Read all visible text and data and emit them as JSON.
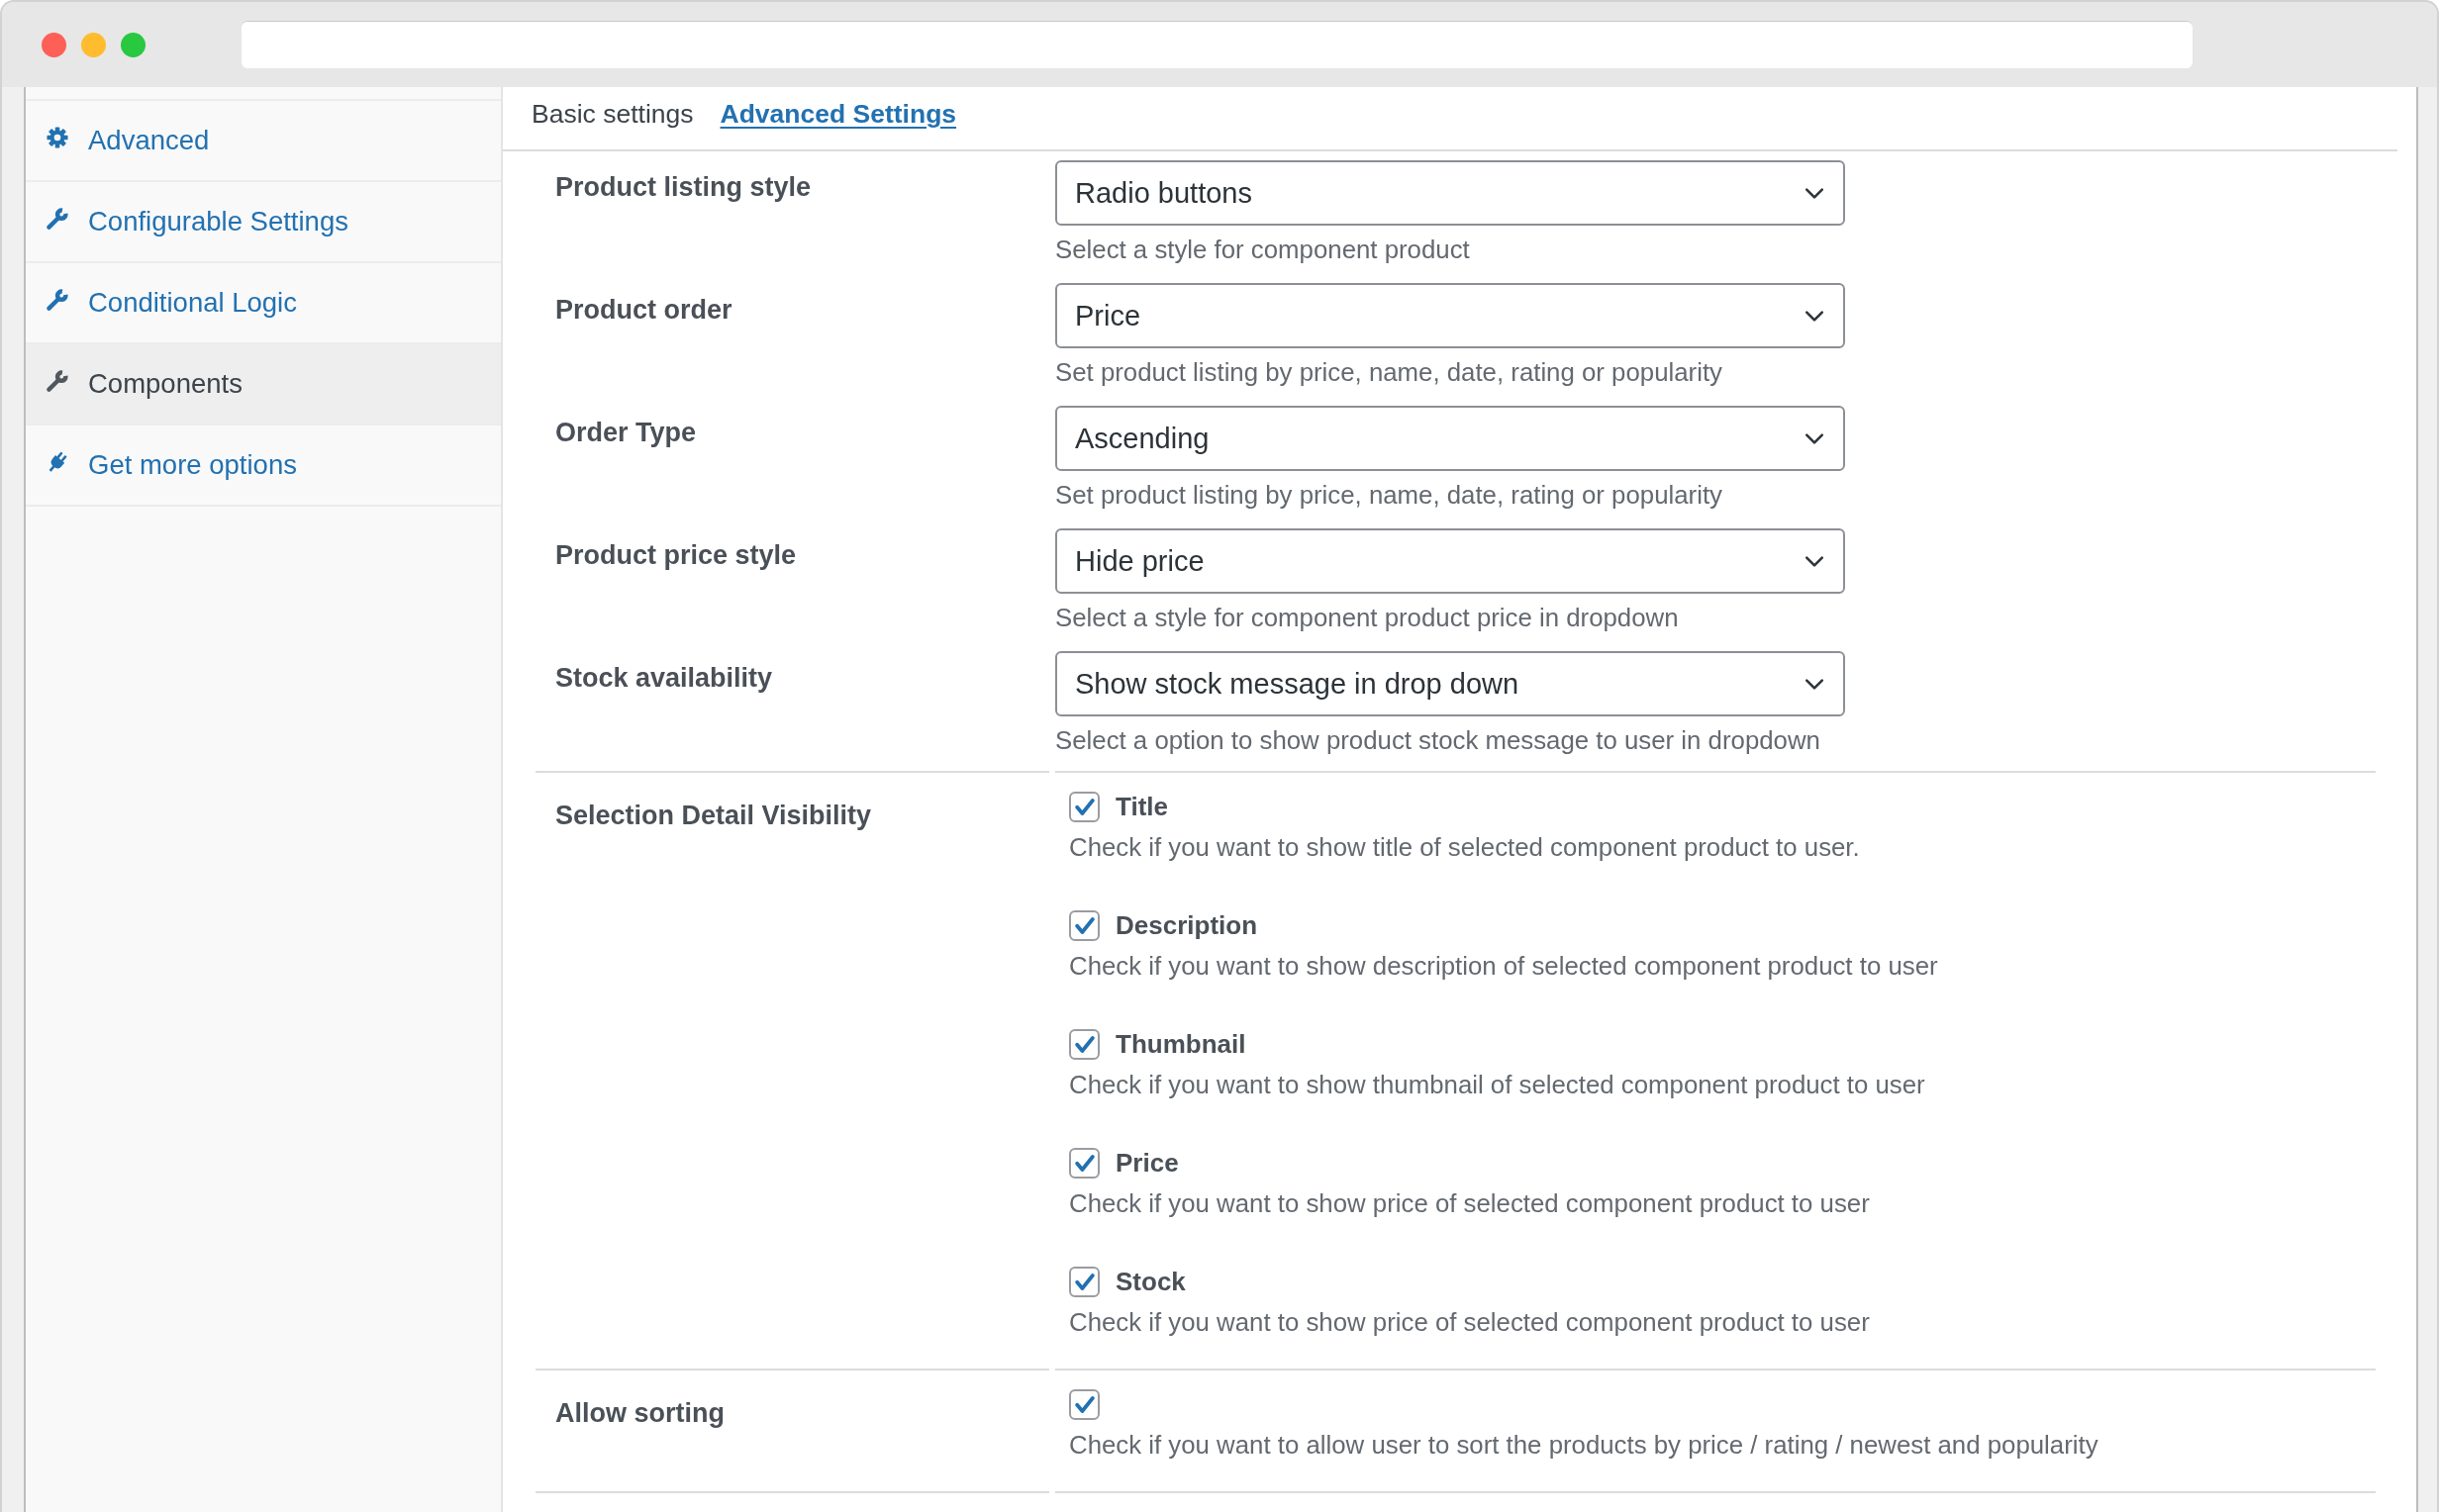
{
  "sidebar": {
    "items": [
      {
        "label": "Advanced",
        "selected": false
      },
      {
        "label": "Configurable Settings",
        "selected": false
      },
      {
        "label": "Conditional Logic",
        "selected": false
      },
      {
        "label": "Components",
        "selected": true
      },
      {
        "label": "Get more options",
        "selected": false
      }
    ]
  },
  "tabs": [
    {
      "label": "Basic settings",
      "selected": false
    },
    {
      "label": "Advanced Settings",
      "selected": true
    }
  ],
  "form": {
    "sections": [
      {
        "rows": [
          {
            "kind": "select",
            "label": "Product listing style",
            "value": "Radio buttons",
            "help": "Select a style for component product"
          },
          {
            "kind": "select",
            "label": "Product order",
            "value": "Price",
            "help": "Set product listing by price, name, date, rating or popularity"
          },
          {
            "kind": "select",
            "label": "Order Type",
            "value": "Ascending",
            "help": "Set product listing by price, name, date, rating or popularity"
          },
          {
            "kind": "select",
            "label": "Product price style",
            "value": "Hide price",
            "help": "Select a style for component product price in dropdown"
          },
          {
            "kind": "select",
            "label": "Stock availability",
            "value": "Show stock message in drop down",
            "help": "Select a option to show product stock message to user in dropdown"
          }
        ]
      },
      {
        "rows": [
          {
            "kind": "checkboxes",
            "label": "Selection Detail Visibility",
            "options": [
              {
                "label": "Title",
                "checked": true,
                "help": "Check if you want to show title of selected component product to user."
              },
              {
                "label": "Description",
                "checked": true,
                "help": "Check if you want to show description of selected component product to user"
              },
              {
                "label": "Thumbnail",
                "checked": true,
                "help": "Check if you want to show thumbnail of selected component product to user"
              },
              {
                "label": "Price",
                "checked": true,
                "help": "Check if you want to show price of selected component product to user"
              },
              {
                "label": "Stock",
                "checked": true,
                "help": "Check if you want to show price of selected component product to user"
              }
            ]
          }
        ]
      },
      {
        "rows": [
          {
            "kind": "checkboxes",
            "label": "Allow sorting",
            "options": [
              {
                "checked": true,
                "help": "Check if you want to allow user to sort the products by price / rating / newest and popularity"
              }
            ]
          }
        ]
      }
    ]
  }
}
